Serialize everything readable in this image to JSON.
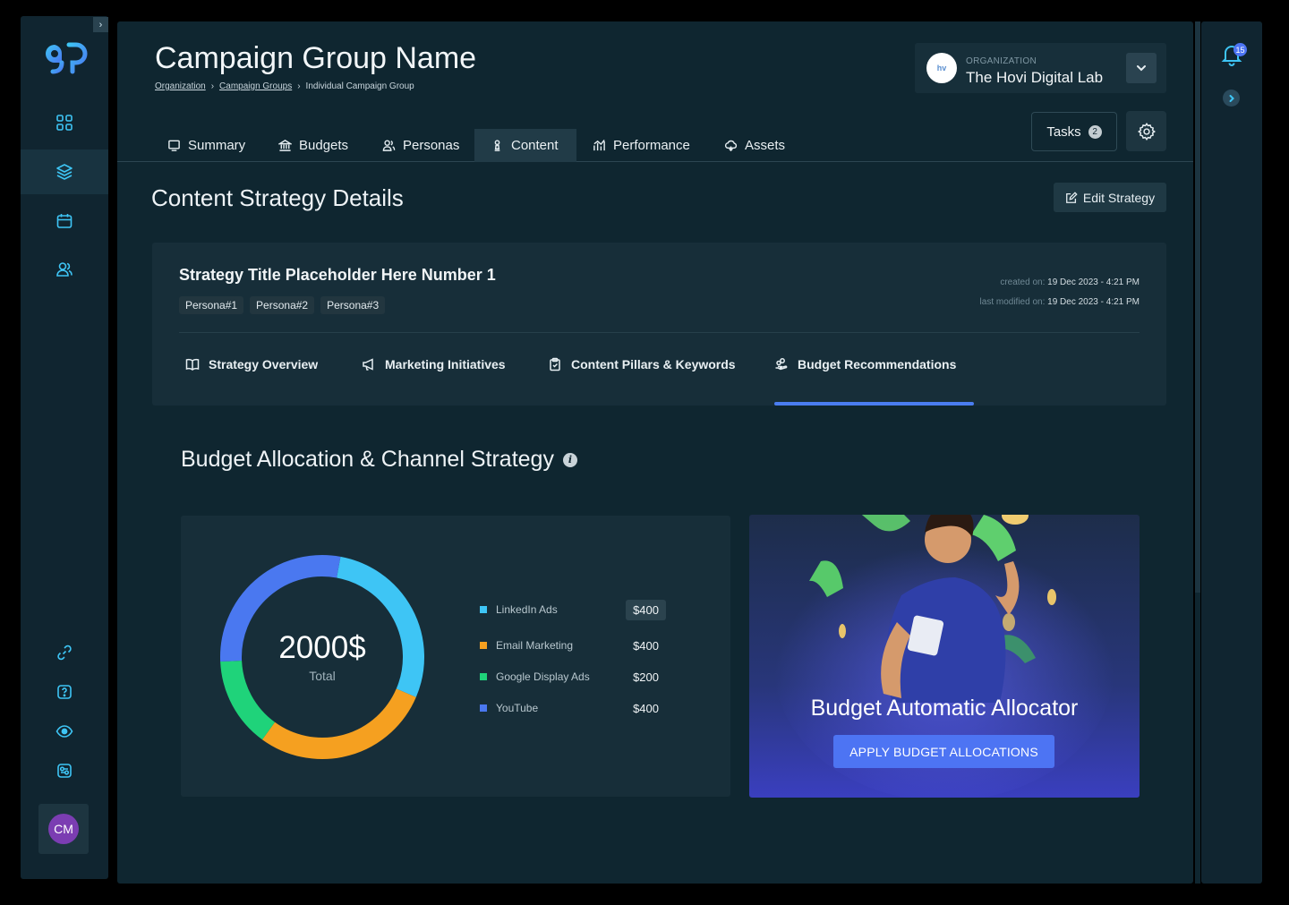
{
  "sidebar": {
    "logo": "gp",
    "nav": [
      {
        "icon": "dashboard-grid-icon",
        "active": false
      },
      {
        "icon": "layers-icon",
        "active": true
      },
      {
        "icon": "calendar-icon",
        "active": false
      },
      {
        "icon": "users-icon",
        "active": false
      }
    ],
    "bottom": [
      {
        "icon": "link-icon"
      },
      {
        "icon": "help-icon"
      },
      {
        "icon": "eye-icon"
      },
      {
        "icon": "settings-panel-icon"
      }
    ],
    "avatar_initials": "CM"
  },
  "header": {
    "title": "Campaign Group Name",
    "breadcrumb": [
      "Organization",
      "Campaign Groups",
      "Individual Campaign Group"
    ],
    "org_label": "ORGANIZATION",
    "org_name": "The Hovi Digital Lab",
    "org_logo": "hv",
    "tasks_label": "Tasks",
    "tasks_count": "2"
  },
  "tabs": [
    "Summary",
    "Budgets",
    "Personas",
    "Content",
    "Performance",
    "Assets"
  ],
  "active_tab": "Content",
  "section": {
    "title": "Content Strategy Details",
    "edit_label": "Edit Strategy"
  },
  "strategy": {
    "title": "Strategy Title Placeholder Here Number 1",
    "personas": [
      "Persona#1",
      "Persona#2",
      "Persona#3"
    ],
    "created_label": "created on:",
    "created_value": "19 Dec 2023 - 4:21 PM",
    "modified_label": "last modified on:",
    "modified_value": "19 Dec 2023 - 4:21 PM",
    "subtabs": [
      "Strategy Overview",
      "Marketing Initiatives",
      "Content Pillars & Keywords",
      "Budget Recommendations"
    ],
    "active_subtab": "Budget Recommendations"
  },
  "budget": {
    "title": "Budget Allocation & Channel Strategy",
    "info_icon": "i",
    "total_value": "2000$",
    "total_label": "Total",
    "legend": [
      {
        "label": "LinkedIn Ads",
        "value": "$400",
        "color": "#3ec5f5"
      },
      {
        "label": "Email Marketing",
        "value": "$400",
        "color": "#f5a020"
      },
      {
        "label": "Google Display Ads",
        "value": "$200",
        "color": "#1fd37a"
      },
      {
        "label": "YouTube",
        "value": "$400",
        "color": "#4a78f0"
      }
    ]
  },
  "chart_data": {
    "type": "pie",
    "categories": [
      "LinkedIn Ads",
      "Email Marketing",
      "Google Display Ads",
      "YouTube"
    ],
    "values": [
      400,
      400,
      200,
      400
    ],
    "colors": [
      "#3ec5f5",
      "#f5a020",
      "#1fd37a",
      "#4a78f0"
    ],
    "title": "",
    "center_value": "2000$",
    "center_label": "Total"
  },
  "promo": {
    "title": "Budget Automatic Allocator",
    "button": "APPLY BUDGET ALLOCATIONS"
  },
  "notifications": {
    "count": "15"
  },
  "colors": {
    "accent": "#4d74f3",
    "bg": "#0f2630",
    "panel": "#172e39"
  }
}
